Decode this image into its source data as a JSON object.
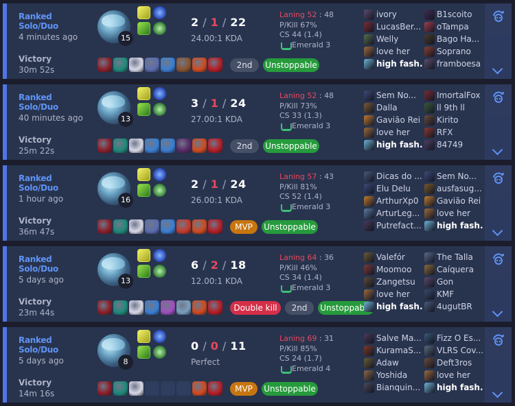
{
  "matches": [
    {
      "queue": "Ranked Solo/Duo",
      "ago": "4 minutes ago",
      "result": "Victory",
      "duration": "30m 52s",
      "level": "15",
      "k": "2",
      "d": "1",
      "a": "22",
      "ratio": "24.00:1 KDA",
      "lan_a": "Laning 52",
      "lan_b": "48",
      "pkill": "P/Kill 67%",
      "cs": "CS 44 (1.4)",
      "rank": "Emerald 3",
      "items": [
        "#8b1f2a",
        "#1e8a7a",
        "#d8d8e8",
        "#5b6db0",
        "#3a7fd4",
        "#8a5430",
        "#d34a1e",
        "#b81c24"
      ],
      "badges": [
        {
          "label": "2nd",
          "kind": "place"
        },
        {
          "label": "Unstoppable",
          "kind": "unst"
        }
      ],
      "team1": [
        {
          "name": "ivory",
          "color": "#5b4b6e"
        },
        {
          "name": "LucasBer...",
          "color": "#7a2d35"
        },
        {
          "name": "Welly",
          "color": "#566d4e"
        },
        {
          "name": "love her",
          "color": "#9b6a3e"
        },
        {
          "name": "high fash...",
          "color": "#6fb2d4",
          "me": true
        }
      ],
      "team2": [
        {
          "name": "B1scoito",
          "color": "#3e2e52"
        },
        {
          "name": "oTampa",
          "color": "#a33d4c"
        },
        {
          "name": "Bago Ha...",
          "color": "#4a3a2a"
        },
        {
          "name": "Soprano",
          "color": "#8a3e30"
        },
        {
          "name": "framboesa",
          "color": "#5e4c6a"
        }
      ]
    },
    {
      "queue": "Ranked Solo/Duo",
      "ago": "40 minutes ago",
      "result": "Victory",
      "duration": "25m 22s",
      "level": "13",
      "k": "3",
      "d": "1",
      "a": "24",
      "ratio": "27.00:1 KDA",
      "lan_a": "Laning 52",
      "lan_b": "48",
      "pkill": "P/Kill 73%",
      "cs": "CS 33 (1.3)",
      "rank": "Emerald 3",
      "items": [
        "#8b1f2a",
        "#1e8a7a",
        "#d8d8e8",
        "#3a7fd4",
        "#3a7fd4",
        "#5a2a6a",
        "#d34a1e",
        "#b81c24"
      ],
      "badges": [
        {
          "label": "2nd",
          "kind": "place"
        },
        {
          "label": "Unstoppable",
          "kind": "unst"
        }
      ],
      "team1": [
        {
          "name": "Sem No...",
          "color": "#3d4b7a"
        },
        {
          "name": "Dalla",
          "color": "#7a5a3a"
        },
        {
          "name": "Gavião Rei",
          "color": "#c07a30"
        },
        {
          "name": "love her",
          "color": "#9b6a3e"
        },
        {
          "name": "high fash...",
          "color": "#6fb2d4",
          "me": true
        }
      ],
      "team2": [
        {
          "name": "ImortalFox",
          "color": "#7a2d35"
        },
        {
          "name": "ll 9th ll",
          "color": "#3a5a3a"
        },
        {
          "name": "Kirito",
          "color": "#6a4a3a"
        },
        {
          "name": "RFX",
          "color": "#8a3a30"
        },
        {
          "name": "84749",
          "color": "#4e3e62"
        }
      ]
    },
    {
      "queue": "Ranked Solo/Duo",
      "ago": "1 hour ago",
      "result": "Victory",
      "duration": "36m 47s",
      "level": "16",
      "k": "2",
      "d": "1",
      "a": "24",
      "ratio": "26.00:1 KDA",
      "lan_a": "Laning 57",
      "lan_b": "43",
      "pkill": "P/Kill 81%",
      "cs": "CS 52 (1.4)",
      "rank": "Emerald 3",
      "items": [
        "#8b1f2a",
        "#1e8a7a",
        "#d8d8e8",
        "#5b6db0",
        "#3a7fd4",
        "#c83a2a",
        "#d34a1e",
        "#b81c24"
      ],
      "badges": [
        {
          "label": "MVP",
          "kind": "mvp"
        },
        {
          "label": "Unstoppable",
          "kind": "unst"
        }
      ],
      "team1": [
        {
          "name": "Dicas do ...",
          "color": "#4a5a7a"
        },
        {
          "name": "Elu Delu",
          "color": "#3d4b7a"
        },
        {
          "name": "ArthurXp0",
          "color": "#c07a30"
        },
        {
          "name": "ArturLeg...",
          "color": "#5a7aa0"
        },
        {
          "name": "Putrefact...",
          "color": "#4a3a5a"
        }
      ],
      "team2": [
        {
          "name": "Sem No...",
          "color": "#3d4b7a"
        },
        {
          "name": "ausfasug...",
          "color": "#7a5a2a"
        },
        {
          "name": "Gavião Rei",
          "color": "#c07a30"
        },
        {
          "name": "love her",
          "color": "#9b6a3e"
        },
        {
          "name": "high fash...",
          "color": "#6fb2d4",
          "me": true
        }
      ]
    },
    {
      "queue": "Ranked Solo/Duo",
      "ago": "5 days ago",
      "result": "Victory",
      "duration": "23m 44s",
      "level": "13",
      "k": "6",
      "d": "2",
      "a": "18",
      "ratio": "12.00:1 KDA",
      "lan_a": "Laning 64",
      "lan_b": "36",
      "pkill": "P/Kill 46%",
      "cs": "CS 34 (1.4)",
      "rank": "Emerald 3",
      "items": [
        "#8b1f2a",
        "#1e8a7a",
        "#d8d8e8",
        "#3a7fd4",
        "#a050c0",
        "#7aa0c0",
        "#d34a1e",
        "#b81c24"
      ],
      "badges": [
        {
          "label": "Double kill",
          "kind": "dbl"
        },
        {
          "label": "2nd",
          "kind": "place"
        },
        {
          "label": "Unstoppable",
          "kind": "unst"
        }
      ],
      "team1": [
        {
          "name": "Valefór",
          "color": "#6a5a3a"
        },
        {
          "name": "Moomoo",
          "color": "#7a3a3a"
        },
        {
          "name": "Zangetsu",
          "color": "#5a4a3a"
        },
        {
          "name": "love her",
          "color": "#9b6a3e"
        },
        {
          "name": "high fash...",
          "color": "#6fb2d4",
          "me": true
        }
      ],
      "team2": [
        {
          "name": "The Talla",
          "color": "#5a6a8a"
        },
        {
          "name": "Caíquera",
          "color": "#8a6a3a"
        },
        {
          "name": "Gon",
          "color": "#5a4a6a"
        },
        {
          "name": "KMF",
          "color": "#3a4a6a"
        },
        {
          "name": "4ugutBR",
          "color": "#4a5a7a"
        }
      ]
    },
    {
      "queue": "Ranked Solo/Duo",
      "ago": "5 days ago",
      "result": "Victory",
      "duration": "14m 16s",
      "level": "8",
      "k": "0",
      "d": "0",
      "a": "11",
      "ratio": "Perfect",
      "lan_a": "Laning 69",
      "lan_b": "31",
      "pkill": "P/Kill 85%",
      "cs": "CS 24 (1.7)",
      "rank": "Emerald 4",
      "items": [
        "#8b1f2a",
        "#1e8a7a",
        "#d8d8e8",
        "",
        "",
        "",
        "#d34a1e",
        "#b81c24"
      ],
      "badges": [
        {
          "label": "MVP",
          "kind": "mvp"
        },
        {
          "label": "Unstoppable",
          "kind": "unst"
        }
      ],
      "team1": [
        {
          "name": "Salve Ma...",
          "color": "#4a3a5a"
        },
        {
          "name": "KuramaS...",
          "color": "#7a3a2a"
        },
        {
          "name": "Adaw",
          "color": "#6a5a3a"
        },
        {
          "name": "Yoshida",
          "color": "#8a6a4a"
        },
        {
          "name": "Bianquin...",
          "color": "#4a4a5a"
        }
      ],
      "team2": [
        {
          "name": "Fizz O Es...",
          "color": "#3a5a7a"
        },
        {
          "name": "VLRS Cov...",
          "color": "#5a6a7a"
        },
        {
          "name": "Deft3ros",
          "color": "#6a4a3a"
        },
        {
          "name": "love her",
          "color": "#9b6a3e"
        },
        {
          "name": "high fash...",
          "color": "#6fb2d4",
          "me": true
        }
      ]
    }
  ]
}
